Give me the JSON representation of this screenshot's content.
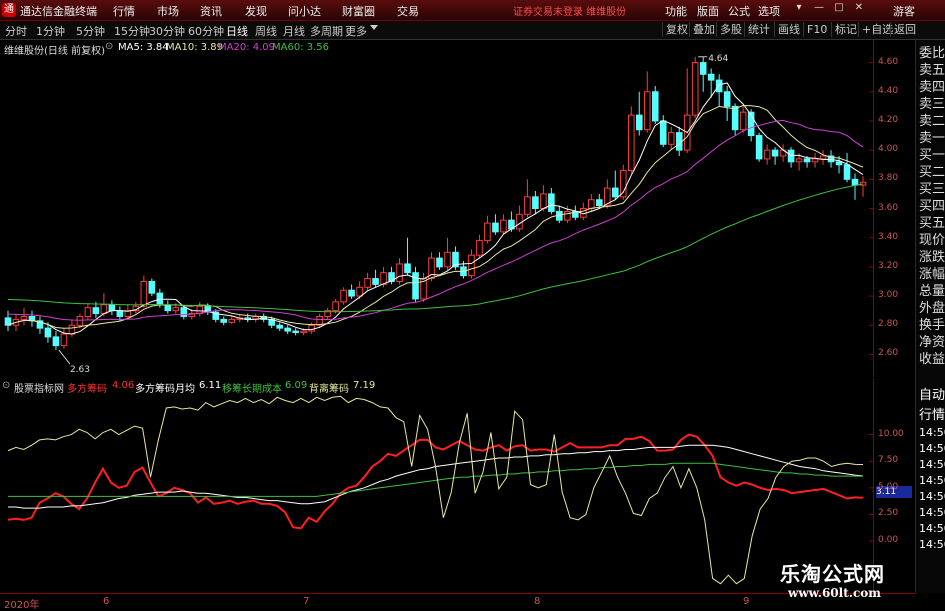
{
  "app": {
    "title": "通达信金融终端",
    "logo_char": "通"
  },
  "menu": [
    "行情",
    "市场",
    "资讯",
    "发现",
    "问小达",
    "财富圈",
    "交易"
  ],
  "marketing_text": "证券交易未登录 维维股份",
  "right_menu": [
    "功能",
    "版面",
    "公式",
    "选项"
  ],
  "guest": "游客",
  "periods": [
    "分时",
    "1分钟",
    "5分钟",
    "15分钟",
    "30分钟",
    "60分钟",
    "日线",
    "周线",
    "月线",
    "多周期",
    "更多"
  ],
  "active_period": "日线",
  "toolbar_right": [
    "复权",
    "叠加",
    "多股",
    "统计",
    "画线",
    "F10",
    "标记",
    "+自选",
    "返回"
  ],
  "stock_header": "维维股份(日线 前复权)",
  "ma_legend": [
    {
      "label": "MA5: 3.84",
      "color": "#ffffff"
    },
    {
      "label": "MA10: 3.89",
      "color": "#e8e8a0"
    },
    {
      "label": "MA20: 4.09",
      "color": "#d040d0"
    },
    {
      "label": "MA60: 3.56",
      "color": "#40c040"
    }
  ],
  "indicator_name": "股票指标网",
  "indicator_legend": [
    {
      "label": "多方筹码",
      "value": "4.06",
      "color": "#ff3030"
    },
    {
      "label": "多方筹码月均",
      "value": "6.11",
      "color": "#ffffff"
    },
    {
      "label": "移筹长期成本",
      "value": "6.09",
      "color": "#40c040"
    },
    {
      "label": "背离筹码",
      "value": "7.19",
      "color": "#e8e8a0"
    }
  ],
  "price_axis_labels": [
    "4.60",
    "4.40",
    "4.20",
    "4.00",
    "3.80",
    "3.60",
    "3.40",
    "3.20",
    "3.00",
    "2.80",
    "2.60"
  ],
  "ind_axis_labels": [
    "10.00",
    "7.50",
    "5.00",
    "2.50",
    "0.00"
  ],
  "ind_current_value": "3.11",
  "price_annotations": {
    "high": "4.64",
    "low": "2.63"
  },
  "right_panel": [
    "委比",
    "卖五",
    "卖四",
    "卖三",
    "卖二",
    "卖一",
    "买一",
    "买二",
    "买三",
    "买四",
    "买五",
    "现价",
    "涨跌",
    "涨幅",
    "总量",
    "外盘",
    "换手",
    "净资",
    "收益",
    "自动",
    "行情",
    "14:50",
    "14:50",
    "14:50",
    "14:50",
    "14:50",
    "14:50",
    "14:50",
    "14:50"
  ],
  "dates": [
    "2020年",
    "6",
    "7",
    "8",
    "9"
  ],
  "watermark": {
    "line1": "乐淘公式网",
    "line2": "www.60lt.com"
  },
  "chart_data": {
    "type": "candlestick",
    "ylim": [
      2.5,
      4.7
    ],
    "candles": [
      [
        2.85,
        2.8,
        2.9,
        2.76
      ],
      [
        2.8,
        2.84,
        2.88,
        2.76
      ],
      [
        2.84,
        2.86,
        2.92,
        2.8
      ],
      [
        2.86,
        2.83,
        2.9,
        2.79
      ],
      [
        2.83,
        2.78,
        2.86,
        2.74
      ],
      [
        2.78,
        2.72,
        2.82,
        2.68
      ],
      [
        2.72,
        2.66,
        2.76,
        2.63
      ],
      [
        2.66,
        2.74,
        2.78,
        2.64
      ],
      [
        2.74,
        2.8,
        2.84,
        2.72
      ],
      [
        2.8,
        2.86,
        2.88,
        2.78
      ],
      [
        2.86,
        2.92,
        2.95,
        2.84
      ],
      [
        2.92,
        2.88,
        2.96,
        2.85
      ],
      [
        2.88,
        2.94,
        3.02,
        2.86
      ],
      [
        2.94,
        2.9,
        2.97,
        2.87
      ],
      [
        2.9,
        2.86,
        2.93,
        2.83
      ],
      [
        2.86,
        2.9,
        2.94,
        2.84
      ],
      [
        2.9,
        2.93,
        2.96,
        2.88
      ],
      [
        2.93,
        3.1,
        3.14,
        2.92
      ],
      [
        3.1,
        3.02,
        3.12,
        3.0
      ],
      [
        3.02,
        2.94,
        3.05,
        2.92
      ],
      [
        2.94,
        2.9,
        2.97,
        2.88
      ],
      [
        2.9,
        2.92,
        2.95,
        2.88
      ],
      [
        2.92,
        2.86,
        2.94,
        2.84
      ],
      [
        2.86,
        2.88,
        2.91,
        2.84
      ],
      [
        2.88,
        2.93,
        2.96,
        2.86
      ],
      [
        2.93,
        2.89,
        2.95,
        2.87
      ],
      [
        2.89,
        2.84,
        2.91,
        2.82
      ],
      [
        2.84,
        2.82,
        2.86,
        2.8
      ],
      [
        2.82,
        2.84,
        2.86,
        2.81
      ],
      [
        2.84,
        2.85,
        2.87,
        2.82
      ],
      [
        2.85,
        2.84,
        2.88,
        2.82
      ],
      [
        2.84,
        2.86,
        2.88,
        2.82
      ],
      [
        2.86,
        2.84,
        2.88,
        2.82
      ],
      [
        2.84,
        2.8,
        2.86,
        2.78
      ],
      [
        2.8,
        2.78,
        2.82,
        2.76
      ],
      [
        2.78,
        2.76,
        2.8,
        2.74
      ],
      [
        2.76,
        2.75,
        2.78,
        2.73
      ],
      [
        2.75,
        2.76,
        2.78,
        2.73
      ],
      [
        2.76,
        2.8,
        2.82,
        2.74
      ],
      [
        2.8,
        2.86,
        2.88,
        2.78
      ],
      [
        2.86,
        2.9,
        2.92,
        2.84
      ],
      [
        2.9,
        2.96,
        2.98,
        2.88
      ],
      [
        2.96,
        3.04,
        3.06,
        2.94
      ],
      [
        3.04,
        3.0,
        3.08,
        2.98
      ],
      [
        3.0,
        3.06,
        3.1,
        2.98
      ],
      [
        3.06,
        3.12,
        3.16,
        3.04
      ],
      [
        3.12,
        3.08,
        3.18,
        3.06
      ],
      [
        3.08,
        3.16,
        3.2,
        3.06
      ],
      [
        3.16,
        3.1,
        3.2,
        3.08
      ],
      [
        3.1,
        3.22,
        3.26,
        3.08
      ],
      [
        3.22,
        3.16,
        3.4,
        3.14
      ],
      [
        3.16,
        2.98,
        3.2,
        2.96
      ],
      [
        2.98,
        3.12,
        3.16,
        2.96
      ],
      [
        3.12,
        3.26,
        3.3,
        3.1
      ],
      [
        3.26,
        3.2,
        3.3,
        3.18
      ],
      [
        3.2,
        3.3,
        3.4,
        3.18
      ],
      [
        3.3,
        3.2,
        3.34,
        3.18
      ],
      [
        3.2,
        3.14,
        3.24,
        3.12
      ],
      [
        3.14,
        3.28,
        3.32,
        3.12
      ],
      [
        3.28,
        3.38,
        3.42,
        3.26
      ],
      [
        3.38,
        3.5,
        3.55,
        3.36
      ],
      [
        3.5,
        3.44,
        3.56,
        3.42
      ],
      [
        3.44,
        3.52,
        3.56,
        3.42
      ],
      [
        3.52,
        3.46,
        3.58,
        3.44
      ],
      [
        3.46,
        3.56,
        3.62,
        3.44
      ],
      [
        3.56,
        3.68,
        3.8,
        3.54
      ],
      [
        3.68,
        3.6,
        3.72,
        3.56
      ],
      [
        3.6,
        3.7,
        3.76,
        3.58
      ],
      [
        3.7,
        3.58,
        3.74,
        3.56
      ],
      [
        3.58,
        3.52,
        3.62,
        3.5
      ],
      [
        3.52,
        3.58,
        3.62,
        3.5
      ],
      [
        3.58,
        3.54,
        3.62,
        3.52
      ],
      [
        3.54,
        3.6,
        3.64,
        3.52
      ],
      [
        3.6,
        3.66,
        3.7,
        3.58
      ],
      [
        3.66,
        3.62,
        3.7,
        3.6
      ],
      [
        3.62,
        3.74,
        3.8,
        3.6
      ],
      [
        3.74,
        3.68,
        3.86,
        3.66
      ],
      [
        3.68,
        3.86,
        3.9,
        3.66
      ],
      [
        3.86,
        4.24,
        4.3,
        3.84
      ],
      [
        4.24,
        4.14,
        4.4,
        4.1
      ],
      [
        4.14,
        4.4,
        4.54,
        4.12
      ],
      [
        4.4,
        4.2,
        4.44,
        4.18
      ],
      [
        4.2,
        4.04,
        4.24,
        4.02
      ],
      [
        4.04,
        4.12,
        4.16,
        4.0
      ],
      [
        4.12,
        4.0,
        4.16,
        3.96
      ],
      [
        4.0,
        4.24,
        4.56,
        3.98
      ],
      [
        4.24,
        4.6,
        4.64,
        4.22
      ],
      [
        4.6,
        4.52,
        4.64,
        4.4
      ],
      [
        4.52,
        4.48,
        4.56,
        4.36
      ],
      [
        4.48,
        4.4,
        4.52,
        4.3
      ],
      [
        4.4,
        4.3,
        4.44,
        4.2
      ],
      [
        4.3,
        4.14,
        4.32,
        4.1
      ],
      [
        4.14,
        4.26,
        4.3,
        4.12
      ],
      [
        4.26,
        4.1,
        4.28,
        4.06
      ],
      [
        4.1,
        3.94,
        4.12,
        3.92
      ],
      [
        3.94,
        4.0,
        4.04,
        3.9
      ],
      [
        4.0,
        3.96,
        4.02,
        3.9
      ],
      [
        3.96,
        4.0,
        4.04,
        3.92
      ],
      [
        4.0,
        3.92,
        4.02,
        3.88
      ],
      [
        3.92,
        3.94,
        3.98,
        3.86
      ],
      [
        3.94,
        3.92,
        3.96,
        3.88
      ],
      [
        3.92,
        3.94,
        3.98,
        3.88
      ],
      [
        3.94,
        3.96,
        4.0,
        3.9
      ],
      [
        3.96,
        3.92,
        4.0,
        3.88
      ],
      [
        3.92,
        3.9,
        3.96,
        3.84
      ],
      [
        3.9,
        3.8,
        3.98,
        3.78
      ],
      [
        3.8,
        3.76,
        3.84,
        3.66
      ],
      [
        3.76,
        3.78,
        3.82,
        3.68
      ]
    ],
    "ind_ylim": [
      -4.5,
      14.0
    ],
    "ind_series": [
      {
        "label": "多方筹码",
        "color": "#ff2020",
        "values": [
          2.0,
          2.1,
          2.0,
          2.2,
          3.6,
          4.0,
          4.5,
          4.2,
          3.5,
          3.0,
          4.0,
          5.5,
          6.8,
          5.5,
          5.0,
          5.2,
          6.5,
          6.9,
          5.5,
          4.2,
          4.5,
          5.0,
          4.8,
          4.5,
          3.6,
          4.1,
          3.5,
          3.6,
          3.8,
          3.5,
          3.7,
          3.8,
          3.5,
          3.5,
          3.3,
          2.7,
          1.3,
          1.2,
          2.2,
          1.8,
          2.8,
          3.5,
          4.5,
          5.0,
          5.2,
          6.0,
          7.0,
          7.5,
          8.2,
          8.0,
          8.5,
          9.0,
          9.5,
          9.5,
          8.8,
          8.6,
          9.0,
          9.4,
          9.0,
          8.6,
          8.5,
          8.8,
          9.0,
          8.5,
          8.9,
          9.0,
          8.5,
          8.6,
          8.6,
          8.4,
          8.8,
          9.2,
          8.8,
          8.8,
          8.8,
          8.8,
          9.0,
          9.0,
          9.6,
          9.6,
          9.8,
          9.4,
          8.5,
          8.5,
          8.6,
          9.5,
          10.0,
          9.8,
          9.0,
          8.0,
          6.0,
          5.5,
          5.2,
          5.5,
          5.3,
          5.0,
          4.8,
          4.9,
          4.8,
          4.5,
          4.6,
          4.7,
          4.8,
          4.9,
          4.6,
          4.3,
          4.0,
          4.1,
          4.06
        ]
      },
      {
        "label": "多方筹码月均",
        "color": "#ffffff",
        "values": [
          3.2,
          3.2,
          3.1,
          3.1,
          3.1,
          3.2,
          3.2,
          3.2,
          3.3,
          3.3,
          3.4,
          3.5,
          3.6,
          3.8,
          4.0,
          4.1,
          4.3,
          4.4,
          4.5,
          4.6,
          4.6,
          4.6,
          4.7,
          4.6,
          4.5,
          4.5,
          4.4,
          4.3,
          4.2,
          4.1,
          4.1,
          4.0,
          3.9,
          3.8,
          3.8,
          3.7,
          3.6,
          3.5,
          3.5,
          3.6,
          3.7,
          4.0,
          4.3,
          4.6,
          4.8,
          5.0,
          5.3,
          5.6,
          5.8,
          6.1,
          6.3,
          6.5,
          6.7,
          6.8,
          7.0,
          7.1,
          7.2,
          7.3,
          7.4,
          7.5,
          7.6,
          7.7,
          7.8,
          7.8,
          7.9,
          7.9,
          8.0,
          8.0,
          8.1,
          8.1,
          8.2,
          8.2,
          8.3,
          8.3,
          8.4,
          8.4,
          8.5,
          8.5,
          8.6,
          8.6,
          8.7,
          8.8,
          8.8,
          8.8,
          8.8,
          8.9,
          9.0,
          9.0,
          9.0,
          9.0,
          8.9,
          8.8,
          8.6,
          8.4,
          8.2,
          8.0,
          7.8,
          7.6,
          7.4,
          7.2,
          7.0,
          6.9,
          6.8,
          6.6,
          6.5,
          6.4,
          6.3,
          6.2,
          6.11
        ]
      },
      {
        "label": "移筹长期成本",
        "color": "#40c040",
        "values": [
          4.2,
          4.2,
          4.2,
          4.2,
          4.2,
          4.2,
          4.2,
          4.2,
          4.2,
          4.2,
          4.2,
          4.2,
          4.2,
          4.2,
          4.2,
          4.2,
          4.2,
          4.2,
          4.2,
          4.2,
          4.2,
          4.2,
          4.2,
          4.2,
          4.2,
          4.2,
          4.2,
          4.2,
          4.2,
          4.2,
          4.2,
          4.2,
          4.2,
          4.2,
          4.2,
          4.2,
          4.2,
          4.2,
          4.2,
          4.2,
          4.3,
          4.4,
          4.5,
          4.6,
          4.7,
          4.8,
          4.9,
          5.0,
          5.1,
          5.2,
          5.3,
          5.4,
          5.5,
          5.6,
          5.7,
          5.8,
          5.9,
          6.0,
          6.0,
          6.1,
          6.1,
          6.2,
          6.2,
          6.3,
          6.3,
          6.4,
          6.4,
          6.5,
          6.5,
          6.6,
          6.6,
          6.7,
          6.7,
          6.8,
          6.8,
          6.9,
          6.9,
          7.0,
          7.0,
          7.1,
          7.1,
          7.2,
          7.2,
          7.2,
          7.3,
          7.3,
          7.3,
          7.3,
          7.3,
          7.3,
          7.2,
          7.1,
          7.0,
          6.9,
          6.8,
          6.7,
          6.6,
          6.5,
          6.4,
          6.4,
          6.3,
          6.3,
          6.2,
          6.2,
          6.1,
          6.1,
          6.1,
          6.1,
          6.09
        ]
      },
      {
        "label": "背离筹码",
        "color": "#e8e8a0",
        "values": [
          8.5,
          8.8,
          8.6,
          9.0,
          9.5,
          9.6,
          9.5,
          9.8,
          10.0,
          10.5,
          10.2,
          9.6,
          10.2,
          10.5,
          10.0,
          10.4,
          10.8,
          10.6,
          6.0,
          9.5,
          12.5,
          12.6,
          12.4,
          12.5,
          12.3,
          13.0,
          12.6,
          12.9,
          13.2,
          13.0,
          13.4,
          13.0,
          13.3,
          12.9,
          13.5,
          13.2,
          13.0,
          13.4,
          13.0,
          13.5,
          13.2,
          13.5,
          13.6,
          13.0,
          13.4,
          13.3,
          13.0,
          12.6,
          12.5,
          11.6,
          11.2,
          7.0,
          11.8,
          10.5,
          7.0,
          2.2,
          4.6,
          9.2,
          12.0,
          4.5,
          6.5,
          10.2,
          4.9,
          6.0,
          12.2,
          11.4,
          5.3,
          5.0,
          5.3,
          10.0,
          4.6,
          2.2,
          2.0,
          2.5,
          5.0,
          6.5,
          8.0,
          6.0,
          4.5,
          2.6,
          2.4,
          4.0,
          4.5,
          6.0,
          7.0,
          5.0,
          6.8,
          5.0,
          2.0,
          -3.5,
          -4.0,
          -3.2,
          -4.0,
          -3.5,
          0.5,
          3.0,
          4.0,
          6.0,
          7.0,
          7.5,
          7.6,
          7.8,
          7.8,
          7.5,
          7.0,
          7.2,
          7.3,
          7.2,
          7.19
        ]
      }
    ]
  }
}
